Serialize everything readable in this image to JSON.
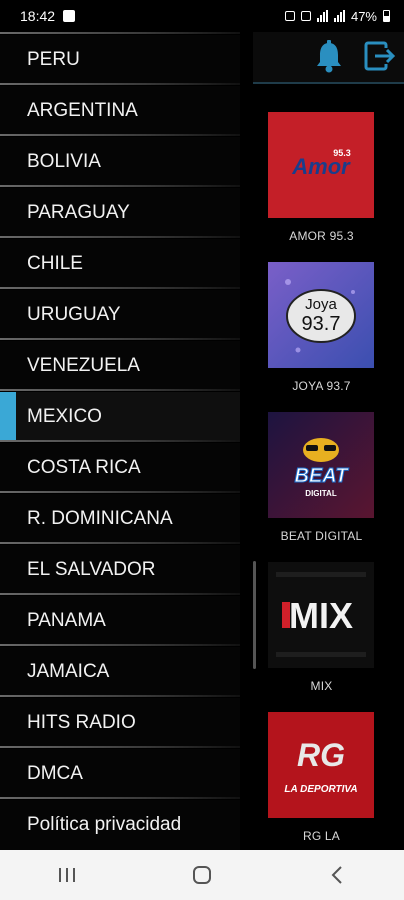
{
  "status_bar": {
    "time": "18:42",
    "battery": "47%"
  },
  "drawer": {
    "items": [
      {
        "label": "PERU",
        "active": false
      },
      {
        "label": "ARGENTINA",
        "active": false
      },
      {
        "label": "BOLIVIA",
        "active": false
      },
      {
        "label": "PARAGUAY",
        "active": false
      },
      {
        "label": "CHILE",
        "active": false
      },
      {
        "label": "URUGUAY",
        "active": false
      },
      {
        "label": "VENEZUELA",
        "active": false
      },
      {
        "label": "MEXICO",
        "active": true
      },
      {
        "label": "COSTA RICA",
        "active": false
      },
      {
        "label": "R. DOMINICANA",
        "active": false
      },
      {
        "label": "EL SALVADOR",
        "active": false
      },
      {
        "label": "PANAMA",
        "active": false
      },
      {
        "label": "JAMAICA",
        "active": false
      },
      {
        "label": "HITS RADIO",
        "active": false
      },
      {
        "label": "DMCA",
        "active": false
      },
      {
        "label": "Política privacidad",
        "active": false
      }
    ],
    "accent_color": "#3aa8d6"
  },
  "toolbar": {
    "icons": [
      "bell-icon",
      "exit-icon"
    ],
    "accent_color": "#2a8fc0"
  },
  "stations": [
    {
      "name": "AMOR 95.3",
      "logo_text": "Amor",
      "logo_sub": "95.3",
      "bg": "#c8202a"
    },
    {
      "name": "JOYA 93.7",
      "logo_text": "Joya",
      "logo_sub": "93.7",
      "bg": "#5a5ab8"
    },
    {
      "name": "BEAT DIGITAL",
      "logo_text": "BEAT",
      "logo_sub": "DIGITAL",
      "bg": "#2a1a4a"
    },
    {
      "name": "MIX",
      "logo_text": "MIX",
      "logo_sub": "",
      "bg": "#0e0e0e"
    },
    {
      "name": "RG LA",
      "logo_text": "RG",
      "logo_sub": "LA DEPORTIVA",
      "bg": "#b4141c"
    }
  ]
}
